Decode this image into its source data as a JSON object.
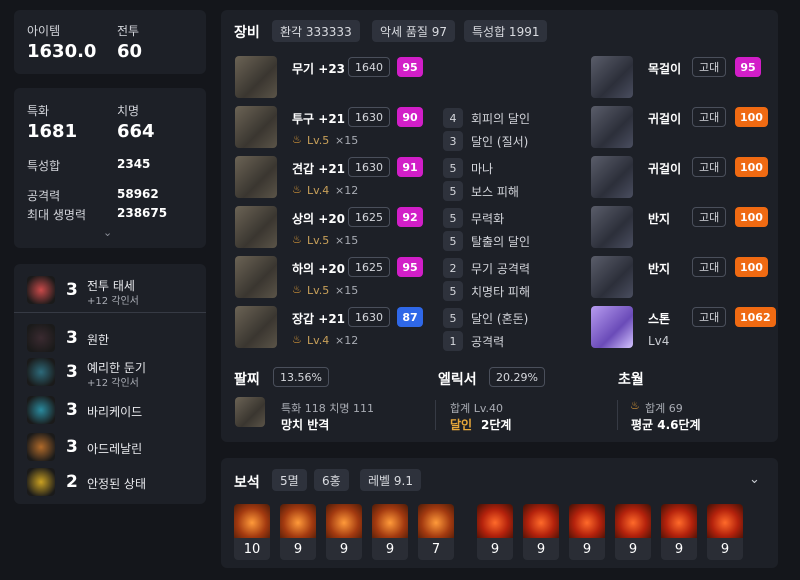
{
  "summary": {
    "item_label": "아이템",
    "item_value": "1630.0",
    "combat_label": "전투",
    "combat_value": "60"
  },
  "stats": {
    "crit_label": "특화",
    "crit_value": "1681",
    "swift_label": "치명",
    "swift_value": "664",
    "total_label": "특성합",
    "total_value": "2345",
    "atk_label": "공격력",
    "atk_value": "58962",
    "hp_label": "최대 생명력",
    "hp_value": "238675"
  },
  "engravings": [
    {
      "level": "3",
      "name": "전투 태세",
      "sub": "+12 각인서"
    },
    {
      "level": "3",
      "name": "원한",
      "sub": ""
    },
    {
      "level": "3",
      "name": "예리한 둔기",
      "sub": "+12 각인서"
    },
    {
      "level": "3",
      "name": "바리케이드",
      "sub": ""
    },
    {
      "level": "3",
      "name": "아드레날린",
      "sub": ""
    },
    {
      "level": "2",
      "name": "안정된 상태",
      "sub": ""
    }
  ],
  "equip": {
    "title": "장비",
    "chips": [
      "환각 333333",
      "악세 품질 97",
      "특성합 1991"
    ],
    "gear": [
      {
        "name": "무기 +23",
        "ilvl": "1640",
        "quality": "95",
        "qcolor": "p",
        "tier": "",
        "count": "",
        "effects": []
      },
      {
        "name": "투구 +21",
        "ilvl": "1630",
        "quality": "90",
        "qcolor": "p",
        "tier": "Lv.5",
        "count": "×15",
        "effects": [
          {
            "n": "4",
            "t": "회피의 달인"
          },
          {
            "n": "3",
            "t": "달인 (질서)"
          }
        ]
      },
      {
        "name": "견갑 +21",
        "ilvl": "1630",
        "quality": "91",
        "qcolor": "p",
        "tier": "Lv.4",
        "count": "×12",
        "effects": [
          {
            "n": "5",
            "t": "마나"
          },
          {
            "n": "5",
            "t": "보스 피해"
          }
        ]
      },
      {
        "name": "상의 +20",
        "ilvl": "1625",
        "quality": "92",
        "qcolor": "p",
        "tier": "Lv.5",
        "count": "×15",
        "effects": [
          {
            "n": "5",
            "t": "무력화"
          },
          {
            "n": "5",
            "t": "탈출의 달인"
          }
        ]
      },
      {
        "name": "하의 +20",
        "ilvl": "1625",
        "quality": "95",
        "qcolor": "p",
        "tier": "Lv.5",
        "count": "×15",
        "effects": [
          {
            "n": "2",
            "t": "무기 공격력"
          },
          {
            "n": "5",
            "t": "치명타 피해"
          }
        ]
      },
      {
        "name": "장갑 +21",
        "ilvl": "1630",
        "quality": "87",
        "qcolor": "b",
        "tier": "Lv.4",
        "count": "×12",
        "effects": [
          {
            "n": "5",
            "t": "달인 (혼돈)"
          },
          {
            "n": "1",
            "t": "공격력"
          }
        ]
      }
    ],
    "acc": [
      {
        "name": "목걸이",
        "grade": "고대",
        "quality": "95",
        "qcolor": "p"
      },
      {
        "name": "귀걸이",
        "grade": "고대",
        "quality": "100",
        "qcolor": "o"
      },
      {
        "name": "귀걸이",
        "grade": "고대",
        "quality": "100",
        "qcolor": "o"
      },
      {
        "name": "반지",
        "grade": "고대",
        "quality": "100",
        "qcolor": "o"
      },
      {
        "name": "반지",
        "grade": "고대",
        "quality": "100",
        "qcolor": "o"
      },
      {
        "name": "스톤",
        "grade": "고대",
        "quality": "1062",
        "qcolor": "o",
        "sub": "Lv4"
      }
    ],
    "bracelet": {
      "label": "팔찌",
      "pct": "13.56%",
      "stats": "특화 118  치명 111",
      "effects": "망치  반격"
    },
    "elixir": {
      "label": "엘릭서",
      "pct": "20.29%",
      "total": "합계 Lv.40",
      "eff_name": "달인",
      "eff_level": "2단계"
    },
    "transcend": {
      "label": "초월",
      "total": "합계 69",
      "avg": "평균 4.6단계"
    }
  },
  "gems": {
    "title": "보석",
    "chips": [
      "5멸",
      "6홍",
      "레벨 9.1"
    ],
    "items": [
      {
        "lv": "10",
        "kind": "m"
      },
      {
        "lv": "9",
        "kind": "m"
      },
      {
        "lv": "9",
        "kind": "m"
      },
      {
        "lv": "9",
        "kind": "m"
      },
      {
        "lv": "7",
        "kind": "m"
      },
      {
        "lv": "9",
        "kind": "h"
      },
      {
        "lv": "9",
        "kind": "h"
      },
      {
        "lv": "9",
        "kind": "h"
      },
      {
        "lv": "9",
        "kind": "h"
      },
      {
        "lv": "9",
        "kind": "h"
      },
      {
        "lv": "9",
        "kind": "h"
      }
    ]
  }
}
